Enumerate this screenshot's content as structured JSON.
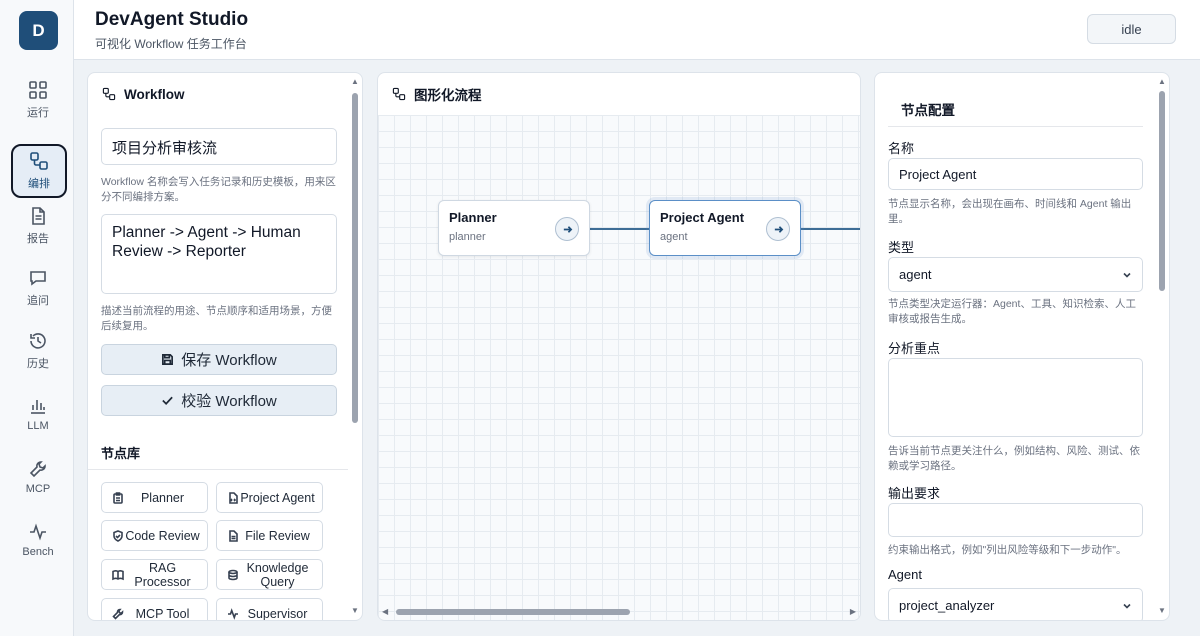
{
  "app": {
    "logo_letter": "D",
    "title": "DevAgent Studio",
    "subtitle": "可视化 Workflow 任务工作台",
    "status": "idle"
  },
  "nav": [
    {
      "label": "运行",
      "icon": "grid-icon"
    },
    {
      "label": "编排",
      "icon": "workflow-icon",
      "active": true
    },
    {
      "label": "报告",
      "icon": "file-icon"
    },
    {
      "label": "追问",
      "icon": "chat-icon"
    },
    {
      "label": "历史",
      "icon": "history-icon"
    },
    {
      "label": "LLM",
      "icon": "bar-chart-icon"
    },
    {
      "label": "MCP",
      "icon": "wrench-icon"
    },
    {
      "label": "Bench",
      "icon": "pulse-icon"
    }
  ],
  "workflow_panel": {
    "title": "Workflow",
    "name_value": "项目分析审核流",
    "name_hint": "Workflow 名称会写入任务记录和历史模板，用来区分不同编排方案。",
    "description_value": "Planner -> Agent -> Human Review -> Reporter",
    "description_hint": "描述当前流程的用途、节点顺序和适用场景，方便后续复用。",
    "save_label": "保存 Workflow",
    "validate_label": "校验 Workflow",
    "library_title": "节点库",
    "library": [
      {
        "label": "Planner",
        "icon": "clipboard-icon"
      },
      {
        "label": "Project Agent",
        "icon": "file-code-icon"
      },
      {
        "label": "Code Review",
        "icon": "shield-icon"
      },
      {
        "label": "File Review",
        "icon": "file-text-icon"
      },
      {
        "label": "RAG Processor",
        "icon": "book-icon"
      },
      {
        "label": "Knowledge Query",
        "icon": "database-icon"
      },
      {
        "label": "MCP Tool",
        "icon": "wrench-icon"
      },
      {
        "label": "Supervisor",
        "icon": "pulse-icon"
      }
    ]
  },
  "canvas_panel": {
    "title": "图形化流程",
    "nodes": [
      {
        "title": "Planner",
        "type": "planner"
      },
      {
        "title": "Project Agent",
        "type": "agent",
        "selected": true
      }
    ]
  },
  "config_panel": {
    "title": "节点配置",
    "name_label": "名称",
    "name_value": "Project Agent",
    "name_hint": "节点显示名称，会出现在画布、时间线和 Agent 输出里。",
    "type_label": "类型",
    "type_value": "agent",
    "type_hint": "节点类型决定运行器：Agent、工具、知识检索、人工审核或报告生成。",
    "focus_label": "分析重点",
    "focus_value": "",
    "focus_hint": "告诉当前节点更关注什么，例如结构、风险、测试、依赖或学习路径。",
    "output_label": "输出要求",
    "output_value": "",
    "output_hint": "约束输出格式，例如\"列出风险等级和下一步动作\"。",
    "agent_label": "Agent",
    "agent_value": "project_analyzer"
  },
  "colors": {
    "brand": "#1f4e79",
    "edge": "#3e6d96",
    "button_bg": "#e7eef5"
  }
}
